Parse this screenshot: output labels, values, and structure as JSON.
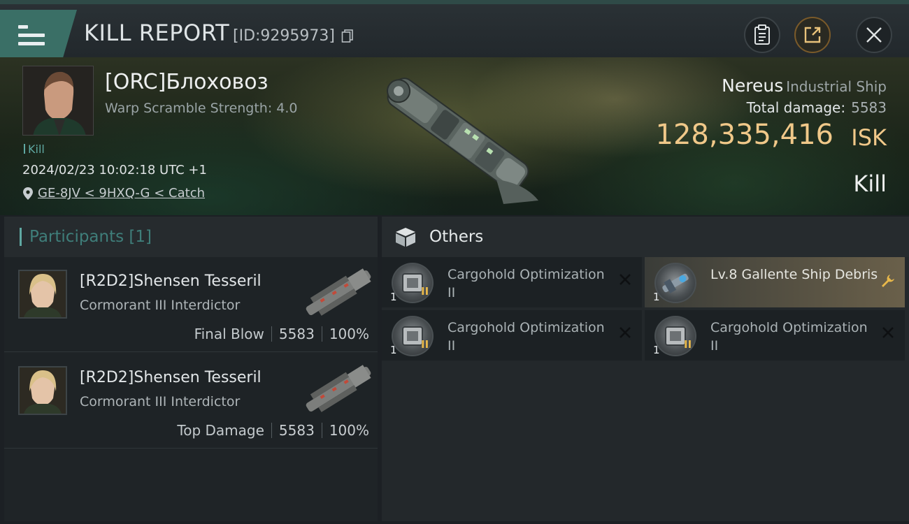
{
  "header": {
    "title": "KILL REPORT",
    "report_id": "[ID:9295973]"
  },
  "victim": {
    "name": "[ORC]Блоховоз",
    "warp_scramble": "Warp Scramble Strength: 4.0",
    "kill_tag": "Kill",
    "timestamp": "2024/02/23 10:02:18 UTC +1",
    "location": "GE-8JV < 9HXQ-G < Catch"
  },
  "ship": {
    "name": "Nereus",
    "class": "Industrial Ship",
    "total_damage_label": "Total damage:",
    "total_damage": "5583",
    "isk_value": "128,335,416",
    "isk_unit": "ISK",
    "result": "Kill"
  },
  "participants": {
    "title": "Participants [1]",
    "rows": [
      {
        "name": "[R2D2]Shensen Tesseril",
        "ship": "Cormorant III Interdictor",
        "role": "Final Blow",
        "damage": "5583",
        "percent": "100%"
      },
      {
        "name": "[R2D2]Shensen Tesseril",
        "ship": "Cormorant III Interdictor",
        "role": "Top Damage",
        "damage": "5583",
        "percent": "100%"
      }
    ]
  },
  "others": {
    "title": "Others",
    "items": [
      {
        "name": "Cargohold Optimization II",
        "qty": "1",
        "meta": "II",
        "status": "destroyed",
        "icon": "cargohold-module-icon"
      },
      {
        "name": "Lv.8 Gallente Ship Debris",
        "qty": "1",
        "meta": "",
        "status": "salvage",
        "icon": "ship-debris-icon"
      },
      {
        "name": "Cargohold Optimization II",
        "qty": "1",
        "meta": "II",
        "status": "destroyed",
        "icon": "cargohold-module-icon"
      },
      {
        "name": "Cargohold Optimization II",
        "qty": "1",
        "meta": "II",
        "status": "destroyed",
        "icon": "cargohold-module-icon"
      }
    ]
  },
  "colors": {
    "accent_teal": "#3a6f66",
    "isk_gold": "#f0c889",
    "highlight_gold": "#6a604a"
  }
}
